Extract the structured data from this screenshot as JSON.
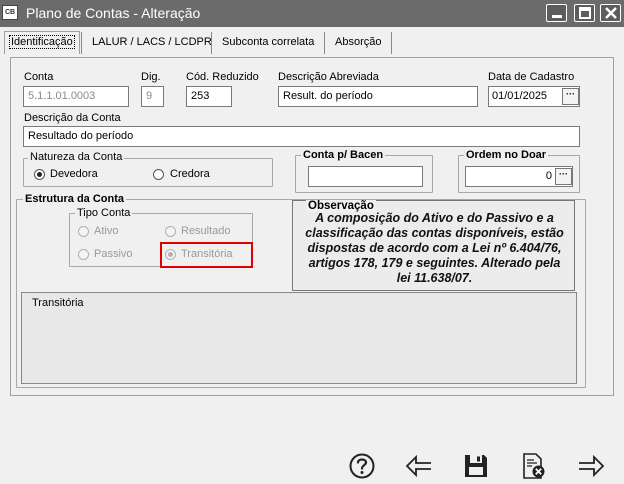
{
  "window": {
    "app_badge": "CB",
    "title": "Plano de Contas - Alteração"
  },
  "tabs": [
    {
      "label": "Identificação",
      "active": true
    },
    {
      "label": "LALUR / LACS / LCDPR",
      "active": false
    },
    {
      "label": "Subconta correlata",
      "active": false
    },
    {
      "label": "Absorção",
      "active": false
    }
  ],
  "form": {
    "conta_label": "Conta",
    "conta_value": "5.1.1.01.0003",
    "dig_label": "Dig.",
    "dig_value": "9",
    "cod_reduzido_label": "Cód. Reduzido",
    "cod_reduzido_value": "253",
    "desc_abreviada_label": "Descrição Abreviada",
    "desc_abreviada_value": "Result. do período",
    "data_cadastro_label": "Data de Cadastro",
    "data_cadastro_value": "01/01/2025",
    "desc_conta_label": "Descrição da Conta",
    "desc_conta_value": "Resultado do período",
    "ellipsis": "···"
  },
  "natureza": {
    "legend": "Natureza da Conta",
    "options": [
      {
        "label": "Devedora",
        "selected": true
      },
      {
        "label": "Credora",
        "selected": false
      }
    ]
  },
  "conta_bacen": {
    "legend": "Conta p/ Bacen",
    "value": ""
  },
  "ordem_doar": {
    "legend": "Ordem no Doar",
    "value": "0"
  },
  "estrutura": {
    "legend": "Estrutura da Conta",
    "tipo_legend": "Tipo Conta",
    "options": [
      {
        "label": "Ativo",
        "selected": false
      },
      {
        "label": "Resultado",
        "selected": false
      },
      {
        "label": "Passivo",
        "selected": false
      },
      {
        "label": "Transitória",
        "selected": true
      }
    ],
    "memo_text": "Transitória"
  },
  "observacao": {
    "legend": "Observação",
    "text": "A composição do Ativo e do Passivo e a classificação das contas disponíveis, estão dispostas de acordo com a Lei nº 6.404/76, artigos 178, 179 e seguintes. Alterado pela lei 11.638/07."
  },
  "toolbar": {
    "help_icon": "question-icon",
    "back_icon": "arrow-left-icon",
    "save_icon": "floppy-disk-icon",
    "cancel_icon": "document-cancel-icon",
    "forward_icon": "arrow-right-icon"
  },
  "colors": {
    "titlebar": "#6b6b6b",
    "highlight": "#e00000"
  }
}
